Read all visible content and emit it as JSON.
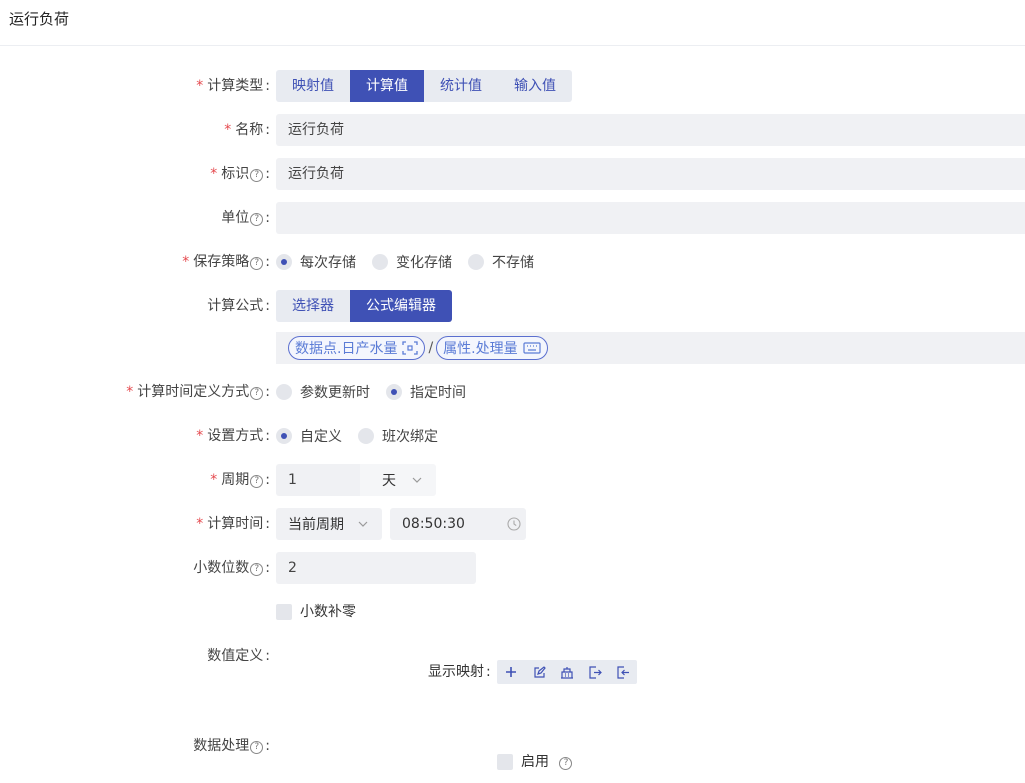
{
  "header": {
    "title": "运行负荷"
  },
  "calc_type": {
    "label": "计算类型",
    "options": [
      "映射值",
      "计算值",
      "统计值",
      "输入值"
    ],
    "selected": "计算值"
  },
  "name": {
    "label": "名称",
    "value": "运行负荷"
  },
  "identifier": {
    "label": "标识",
    "value": "运行负荷"
  },
  "unit": {
    "label": "单位",
    "value": ""
  },
  "save_strategy": {
    "label": "保存策略",
    "options": [
      "每次存储",
      "变化存储",
      "不存储"
    ],
    "selected": "每次存储"
  },
  "formula": {
    "label": "计算公式",
    "modes": [
      "选择器",
      "公式编辑器"
    ],
    "selected_mode": "公式编辑器",
    "expr_left": "数据点.日产水量",
    "operator": "/",
    "expr_right": "属性.处理量"
  },
  "time_def": {
    "label": "计算时间定义方式",
    "options": [
      "参数更新时",
      "指定时间"
    ],
    "selected": "指定时间"
  },
  "setting_mode": {
    "label": "设置方式",
    "options": [
      "自定义",
      "班次绑定"
    ],
    "selected": "自定义"
  },
  "period": {
    "label": "周期",
    "value": "1",
    "unit": "天"
  },
  "calc_time": {
    "label": "计算时间",
    "period_option": "当前周期",
    "time": "08:50:30"
  },
  "decimals": {
    "label": "小数位数",
    "value": "2"
  },
  "zero_pad": {
    "label": "小数补零",
    "checked": false
  },
  "value_def": {
    "label": "数值定义",
    "mapping_label": "显示映射"
  },
  "data_proc": {
    "label": "数据处理",
    "enable_label": "启用",
    "checked": false
  },
  "colors": {
    "primary": "#3f51b5",
    "required": "#e5484d",
    "field_bg": "#f0f1f4"
  },
  "icons": [
    "help-icon",
    "scan-icon",
    "keyboard-icon",
    "chevron-down-icon",
    "clock-icon",
    "plus-icon",
    "edit-icon",
    "building-icon",
    "import-icon",
    "export-icon"
  ]
}
